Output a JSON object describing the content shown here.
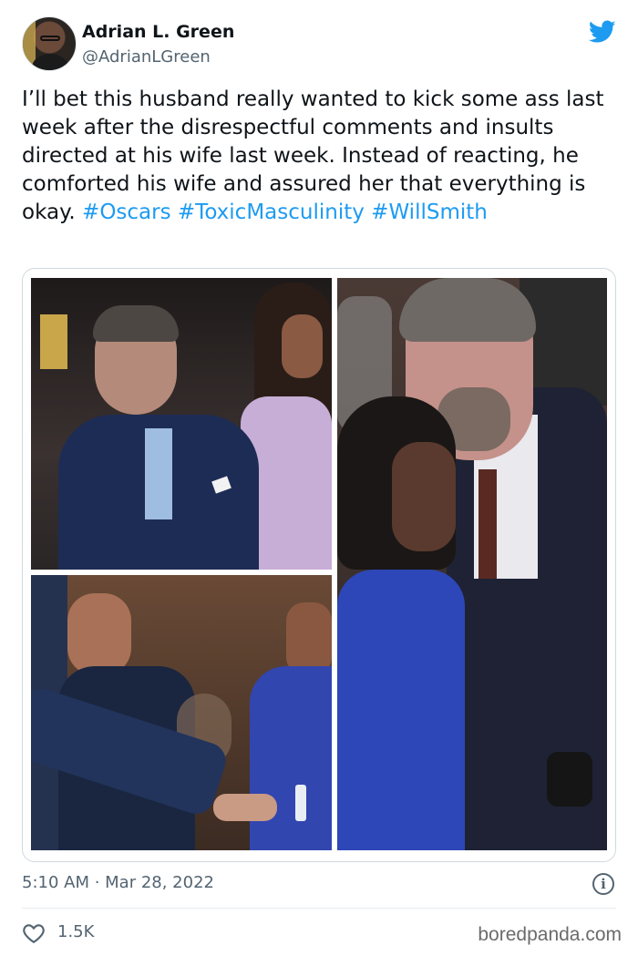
{
  "author": {
    "display_name": "Adrian L. Green",
    "handle": "@AdrianLGreen"
  },
  "icons": {
    "platform": "twitter-bird-icon",
    "info": "info-icon",
    "like": "heart-icon"
  },
  "tweet": {
    "text": "I’ll bet this husband really wanted to kick some ass last week after the disrespectful comments and insults directed at his wife last week.  Instead of reacting, he comforted his wife and assured her that everything is okay. ",
    "hashtags": [
      "#Oscars",
      "#ToxicMasculinity",
      "#WillSmith"
    ],
    "timestamp": "5:10 AM · Mar 28, 2022",
    "likes": "1.5K"
  },
  "media": {
    "photos": [
      "photo-man-seated-suit",
      "photo-man-kissing-woman-forehead",
      "photo-hand-on-hand"
    ]
  },
  "watermark": "boredpanda.com",
  "colors": {
    "link": "#1d9bf0",
    "secondary_text": "#536471",
    "primary_text": "#0f1419",
    "border": "#cfd9de"
  }
}
